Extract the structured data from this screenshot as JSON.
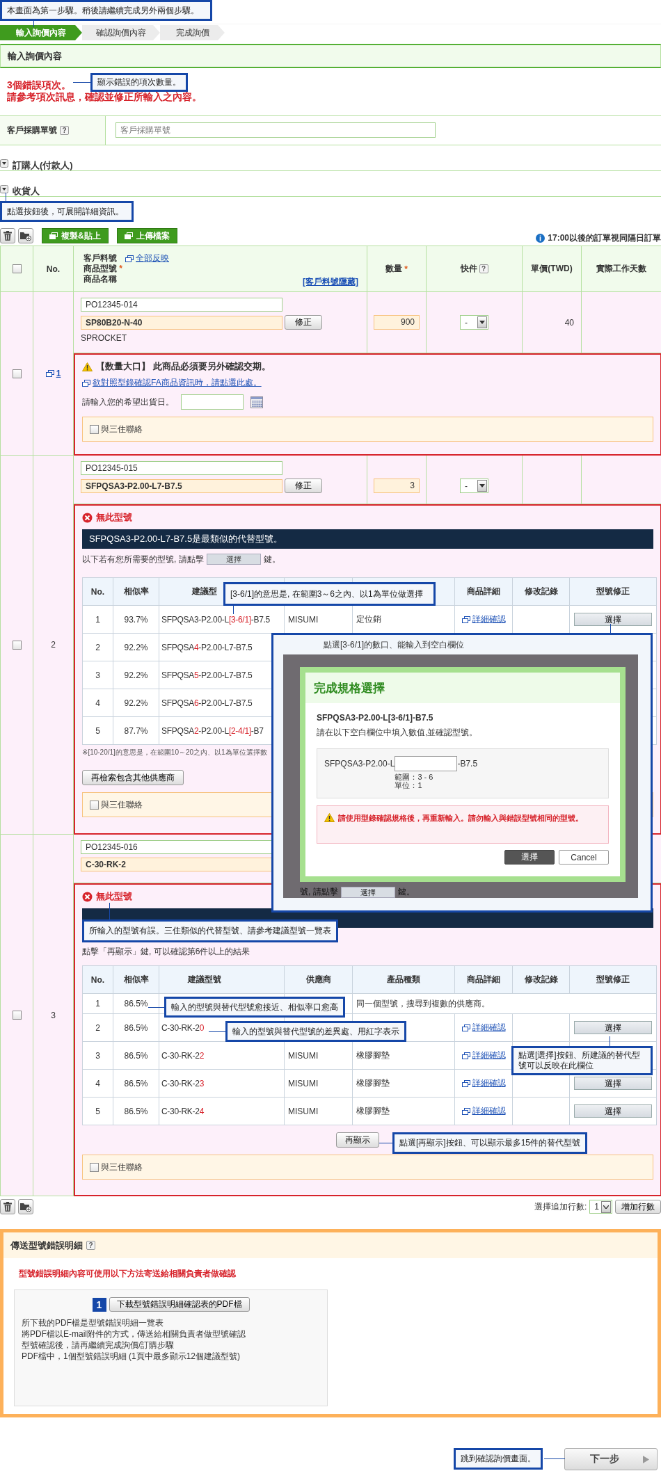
{
  "callouts": [
    {
      "text": "本畫面為第一步驟。稍後請繼續完成另外兩個步驟。"
    },
    {
      "text": "顯示錯誤的項次數量。"
    },
    {
      "text": "點選按鈕後，可展開詳細資訊。"
    },
    {
      "text": "[3-6/1]的意思是, 在範圍3～6之內、以1為單位做選擇"
    },
    {
      "text": "所輸入的型號有誤。三住類似的代替型號、請參考建議型號一覽表"
    },
    {
      "text": "輸入的型號與替代型號愈接近、相似率口愈高"
    },
    {
      "text": "輸入的型號與替代型號的差異處、用紅字表示"
    },
    {
      "text": "點選[選擇]按鈕、所建議的替代型號可以反映在此欄位"
    },
    {
      "text": "點選[再顯示]按鈕、可以顯示最多15件的替代型號"
    },
    {
      "text": "跳到確認詢價畫面。"
    }
  ],
  "steps": [
    {
      "label": "輸入詢價內容",
      "selected": true
    },
    {
      "label": "確認詢價內容",
      "selected": false
    },
    {
      "label": "完成詢價",
      "selected": false
    }
  ],
  "section_title": "輸入詢價內容",
  "errors": [
    "3個錯誤項次。",
    "請參考項次訊息，確認並修正所輸入之內容。"
  ],
  "po_field": {
    "label": "客戶採購單號",
    "help": "?",
    "placeholder": "客戶採購單號"
  },
  "collapsibles": [
    {
      "label": "訂購人(付款人)"
    },
    {
      "label": "收貨人"
    }
  ],
  "toolbar": {
    "buttons": [
      "複製&貼上",
      "上傳檔案"
    ],
    "info": "17:00以後的訂單視同隔日訂單"
  },
  "table": {
    "header": {
      "select_all_checked": false,
      "no": "No.",
      "customer_part": "客戶料號",
      "reflect_all": "全部反映",
      "model": "商品型號",
      "model_mark": "*",
      "name": "商品名稱",
      "hide_link": "[客戶料號隱藏]",
      "qty": "數量",
      "qty_mark": "*",
      "express": "快件",
      "express_help": "?",
      "price": "單價(TWD)",
      "days": "實際工作天數"
    },
    "rows": [
      {
        "checked": false,
        "no": "1",
        "no_is_link": true,
        "customer_part": "PO12345-014",
        "model": "SP80B20-N-40",
        "fix_button": "修正",
        "name": "SPROCKET",
        "qty": "900",
        "express": "-",
        "price": "40",
        "notice": {
          "kind": "warning",
          "title": "【数量大口】 此商品必須要另外確認交期。",
          "link": "欲對照型錄確認FA商品資訊時，請點選此處。",
          "date_label": "請輸入您的希望出貨日。",
          "contact": {
            "label": "與三住聯絡",
            "checked": false
          }
        }
      },
      {
        "checked": false,
        "no": "2",
        "no_is_link": false,
        "customer_part": "PO12345-015",
        "model": "SFPQSA3-P2.00-L7-B7.5",
        "fix_button": "修正",
        "qty": "3",
        "express": "-",
        "notice": {
          "kind": "not_found",
          "title": "無此型號",
          "banner": "SFPQSA3-P2.00-L7-B7.5是最類似的代替型號。",
          "select_line": {
            "before": "以下若有您所需要的型號, 請點擊",
            "key": "選擇",
            "after": "鍵。"
          },
          "columns": [
            "No.",
            "相似率",
            "建議型",
            null,
            null,
            "商品詳細",
            "修改記錄",
            "型號修正"
          ],
          "suggestions": [
            {
              "no": "1",
              "similarity": "93.7%",
              "code": [
                {
                  "text": "SFPQSA3-P2.00-L",
                  "diff": false
                },
                {
                  "text": "[3-6/1]",
                  "diff": true
                },
                {
                  "text": "-B7.5",
                  "diff": false
                }
              ],
              "supplier": "MISUMI",
              "category": "定位銷",
              "detail": "詳細確認",
              "fix": "選擇"
            },
            {
              "no": "2",
              "similarity": "92.2%",
              "code": [
                {
                  "text": "SFPQSA",
                  "diff": false
                },
                {
                  "text": "4",
                  "diff": true
                },
                {
                  "text": "-P2.00-L7-B7.5",
                  "diff": false
                }
              ]
            },
            {
              "no": "3",
              "similarity": "92.2%",
              "code": [
                {
                  "text": "SFPQSA",
                  "diff": false
                },
                {
                  "text": "5",
                  "diff": true
                },
                {
                  "text": "-P2.00-L7-B7.5",
                  "diff": false
                }
              ]
            },
            {
              "no": "4",
              "similarity": "92.2%",
              "code": [
                {
                  "text": "SFPQSA",
                  "diff": false
                },
                {
                  "text": "6",
                  "diff": true
                },
                {
                  "text": "-P2.00-L7-B7.5",
                  "diff": false
                }
              ]
            },
            {
              "no": "5",
              "similarity": "87.7%",
              "code": [
                {
                  "text": "SFPQSA",
                  "diff": false
                },
                {
                  "text": "2",
                  "diff": true
                },
                {
                  "text": "-P2.00-L",
                  "diff": false
                },
                {
                  "text": "[2-4/1]",
                  "diff": true
                },
                {
                  "text": "-B7",
                  "diff": false
                }
              ]
            }
          ],
          "note": "※[10-20/1]的意思是，在範圍10～20之內、以1為單位選擇數",
          "research_button": "再檢索包含其他供應商",
          "contact": {
            "label": "與三住聯絡",
            "checked": false
          }
        }
      },
      {
        "checked": false,
        "no": "3",
        "no_is_link": false,
        "customer_part": "PO12345-016",
        "model": "C-30-RK-2",
        "notice": {
          "kind": "not_found",
          "title": "無此型號",
          "more_line": "點擊「再顯示」鍵, 可以確認第6件以上的結果",
          "columns": [
            "No.",
            "相似率",
            "建議型號",
            "供應商",
            "產品種類",
            "商品詳細",
            "修改記錄",
            "型號修正"
          ],
          "suggestions": [
            {
              "no": "1",
              "similarity": "86.5%",
              "span_note": "同一個型號，搜尋到複數的供應商。"
            },
            {
              "no": "2",
              "similarity": "86.5%",
              "code": [
                {
                  "text": "C-30-RK-2",
                  "diff": false
                },
                {
                  "text": "0",
                  "diff": true
                }
              ],
              "detail": "詳細確認",
              "fix": "選擇"
            },
            {
              "no": "3",
              "similarity": "86.5%",
              "code": [
                {
                  "text": "C-30-RK-2",
                  "diff": false
                },
                {
                  "text": "2",
                  "diff": true
                }
              ],
              "supplier": "MISUMI",
              "category": "橡膠腳墊",
              "detail": "詳細確認"
            },
            {
              "no": "4",
              "similarity": "86.5%",
              "code": [
                {
                  "text": "C-30-RK-2",
                  "diff": false
                },
                {
                  "text": "3",
                  "diff": true
                }
              ],
              "supplier": "MISUMI",
              "category": "橡膠腳墊",
              "detail": "詳細確認",
              "fix": "選擇"
            },
            {
              "no": "5",
              "similarity": "86.5%",
              "code": [
                {
                  "text": "C-30-RK-2",
                  "diff": false
                },
                {
                  "text": "4",
                  "diff": true
                }
              ],
              "supplier": "MISUMI",
              "category": "橡膠腳墊",
              "detail": "詳細確認",
              "fix": "選擇"
            }
          ],
          "redisplay_button": "再顯示",
          "contact": {
            "label": "與三住聯絡",
            "checked": false
          }
        }
      }
    ]
  },
  "modal": {
    "caption": "點選[3-6/1]的數口、能輸入到空白欄位",
    "title": "完成規格選擇",
    "code": "SFPQSA3-P2.00-L[3-6/1]-B7.5",
    "instruction": "請在以下空白欄位中填入數值,並確認型號。",
    "prefix": "SFPQSA3-P2.00-L",
    "suffix": "-B7.5",
    "range": "範圍：3 - 6",
    "unit": "單位：1",
    "warning": "請使用型錄確認規格後，再重新輸入。請勿輸入與錯誤型號相同的型號。",
    "buttons": [
      {
        "label": "選擇",
        "kind": "primary"
      },
      {
        "label": "Cancel",
        "kind": "secondary"
      }
    ],
    "background_line": {
      "before": "號, 請點擊",
      "key": "選擇",
      "after": "鍵。"
    }
  },
  "bottom_toolbar": {
    "add_rows_label": "選擇追加行數:",
    "add_rows_value": "1",
    "add_button": "增加行數"
  },
  "error_report": {
    "title": "傳送型號錯誤明細",
    "help": "?",
    "lead": "型號錯誤明細內容可使用以下方法寄送給相關負責者做確認",
    "step_number": "1",
    "download_button": "下載型號錯誤明細確認表的PDF檔",
    "lines": [
      "所下載的PDF檔是型號錯誤明細一覽表",
      "將PDF檔以E-mail附件的方式，傳送給相關負責者做型號確認",
      "型號確認後，請再繼續完成詢價/訂購步驟",
      "PDF檔中，1個型號錯誤明細 (1頁中最多顯示12個建議型號)"
    ]
  },
  "next_button": "下一步"
}
